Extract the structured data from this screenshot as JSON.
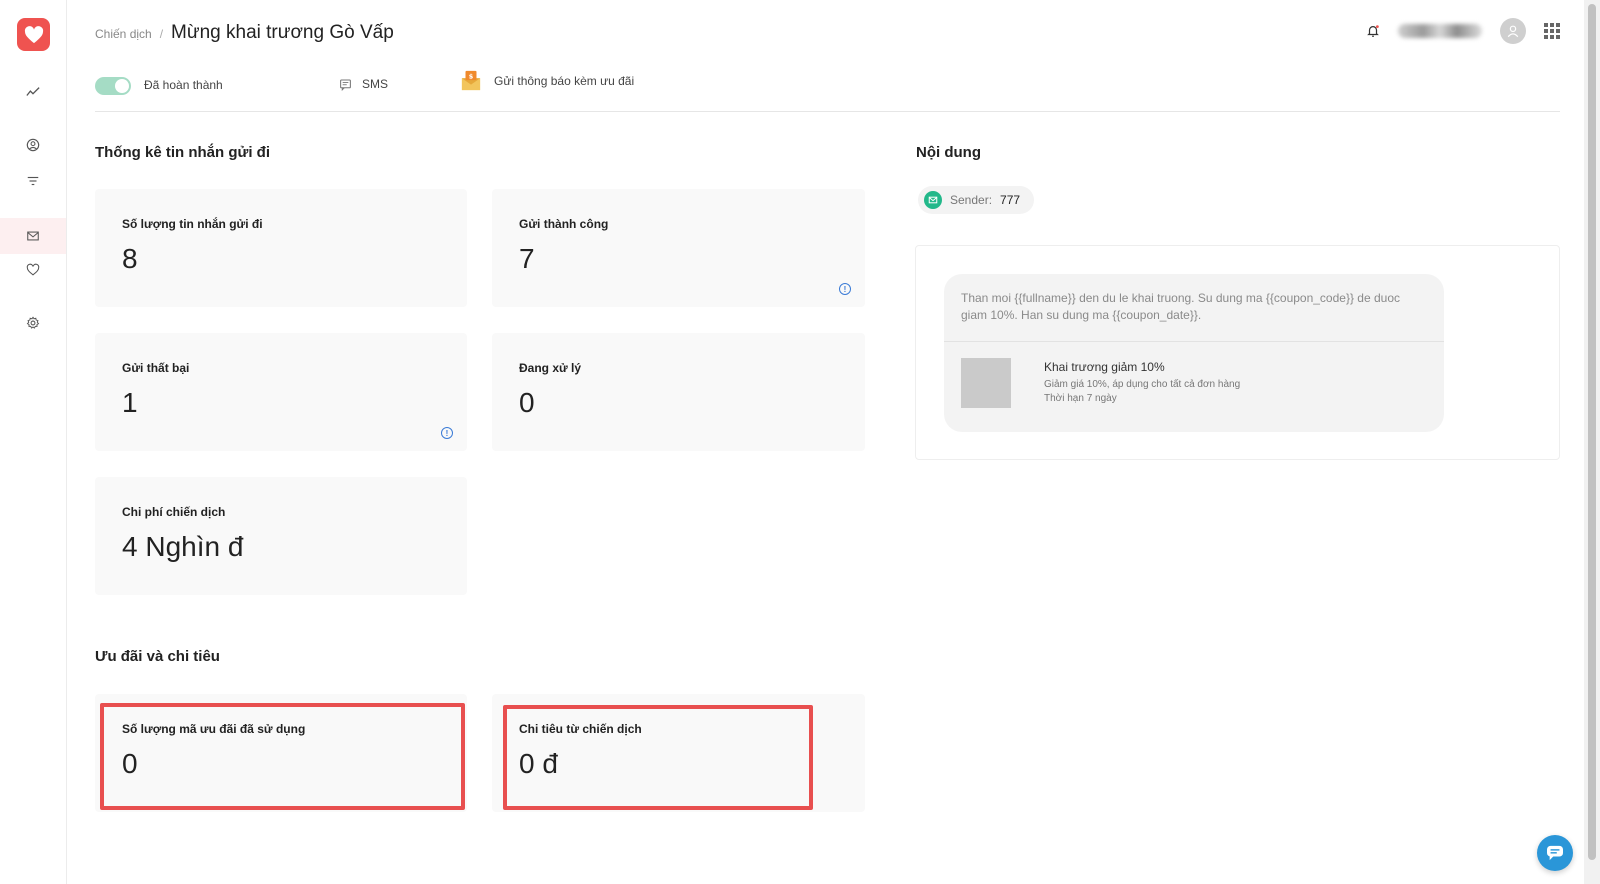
{
  "header": {
    "breadcrumb_parent": "Chiến dịch",
    "breadcrumb_sep": "/",
    "title": "Mừng khai trương Gò Vấp"
  },
  "status": {
    "state_label": "Đã hoàn thành",
    "channel_label": "SMS",
    "campaign_type_label": "Gửi thông báo kèm ưu đãi"
  },
  "stats": {
    "section_title": "Thống kê tin nhắn gửi đi",
    "sent_label": "Số lượng tin nhắn gửi đi",
    "sent_value": "8",
    "success_label": "Gửi thành công",
    "success_value": "7",
    "failed_label": "Gửi thất bại",
    "failed_value": "1",
    "processing_label": "Đang xử lý",
    "processing_value": "0",
    "cost_label": "Chi phí chiến dịch",
    "cost_value": "4 Nghìn đ"
  },
  "offers": {
    "section_title": "Ưu đãi và chi tiêu",
    "codes_used_label": "Số lượng mã ưu đãi đã sử dụng",
    "codes_used_value": "0",
    "spend_label": "Chi tiêu từ chiến dịch",
    "spend_value": "0 đ"
  },
  "content": {
    "section_title": "Nội dung",
    "sender_label": "Sender:",
    "sender_value": "777",
    "message": "Than moi {{fullname}} den du le khai truong. Su dung ma {{coupon_code}} de duoc giam 10%. Han su dung ma {{coupon_date}}.",
    "coupon_title": "Khai trương giảm 10%",
    "coupon_desc": "Giảm giá 10%, áp dụng cho tất cả đơn hàng",
    "coupon_expiry": "Thời hạn 7 ngày"
  },
  "icons": {
    "logo": "heart-icon",
    "nav": [
      "trend-icon",
      "user-circle-icon",
      "filter-icon",
      "mail-icon",
      "heart-outline-icon",
      "gear-icon"
    ]
  },
  "colors": {
    "brand": "#ef5350",
    "toggle_on": "#a5dcc5",
    "highlight": "#e84f4f",
    "sender_badge": "#22b88a",
    "chat": "#2a96d8"
  }
}
